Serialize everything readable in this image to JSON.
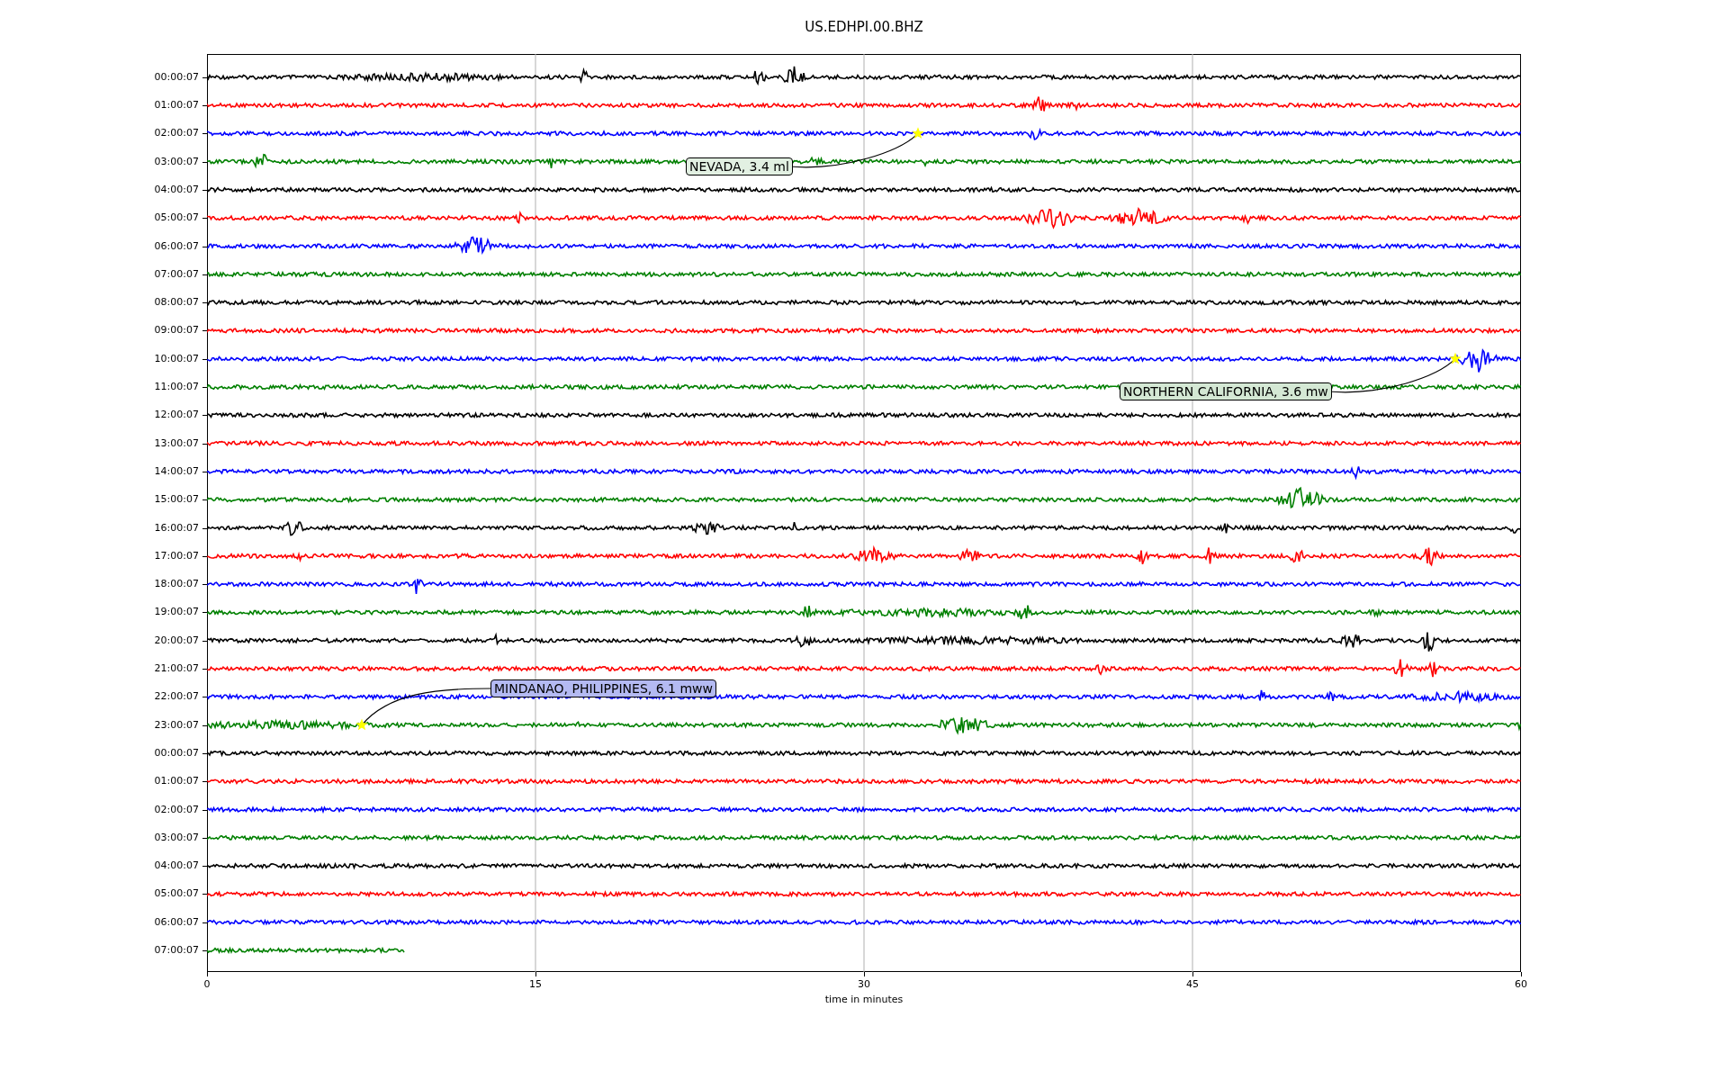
{
  "title": "US.EDHPI.00.BHZ",
  "plot": {
    "rows": [
      {
        "label": "00:00:07",
        "color": "#000000",
        "level": 1
      },
      {
        "label": "01:00:07",
        "color": "#ff0000",
        "level": 1
      },
      {
        "label": "02:00:07",
        "color": "#0000ff",
        "level": 1
      },
      {
        "label": "03:00:07",
        "color": "#008000",
        "level": 1
      },
      {
        "label": "04:00:07",
        "color": "#000000",
        "level": 1
      },
      {
        "label": "05:00:07",
        "color": "#ff0000",
        "level": 1
      },
      {
        "label": "06:00:07",
        "color": "#0000ff",
        "level": 1
      },
      {
        "label": "07:00:07",
        "color": "#008000",
        "level": 1
      },
      {
        "label": "08:00:07",
        "color": "#000000",
        "level": 1
      },
      {
        "label": "09:00:07",
        "color": "#ff0000",
        "level": 1
      },
      {
        "label": "10:00:07",
        "color": "#0000ff",
        "level": 1
      },
      {
        "label": "11:00:07",
        "color": "#008000",
        "level": 1
      },
      {
        "label": "12:00:07",
        "color": "#000000",
        "level": 1
      },
      {
        "label": "13:00:07",
        "color": "#ff0000",
        "level": 1
      },
      {
        "label": "14:00:07",
        "color": "#0000ff",
        "level": 1
      },
      {
        "label": "15:00:07",
        "color": "#008000",
        "level": 1
      },
      {
        "label": "16:00:07",
        "color": "#000000",
        "level": 1
      },
      {
        "label": "17:00:07",
        "color": "#ff0000",
        "level": 1
      },
      {
        "label": "18:00:07",
        "color": "#0000ff",
        "level": 1
      },
      {
        "label": "19:00:07",
        "color": "#008000",
        "level": 1
      },
      {
        "label": "20:00:07",
        "color": "#000000",
        "level": 1
      },
      {
        "label": "21:00:07",
        "color": "#ff0000",
        "level": 1
      },
      {
        "label": "22:00:07",
        "color": "#0000ff",
        "level": 1
      },
      {
        "label": "23:00:07",
        "color": "#008000",
        "level": 1
      },
      {
        "label": "00:00:07",
        "color": "#000000",
        "level": 1
      },
      {
        "label": "01:00:07",
        "color": "#ff0000",
        "level": 1
      },
      {
        "label": "02:00:07",
        "color": "#0000ff",
        "level": 1
      },
      {
        "label": "03:00:07",
        "color": "#008000",
        "level": 1
      },
      {
        "label": "04:00:07",
        "color": "#000000",
        "level": 1
      },
      {
        "label": "05:00:07",
        "color": "#ff0000",
        "level": 1
      },
      {
        "label": "06:00:07",
        "color": "#0000ff",
        "level": 1
      },
      {
        "label": "07:00:07",
        "color": "#008000",
        "level": 0.15
      }
    ],
    "xticks": [
      "0",
      "15",
      "30",
      "45",
      "60"
    ],
    "xlabel": "time in minutes",
    "annotations": [
      {
        "text": "NEVADA, 3.4 ml",
        "color": "#e2f0e2"
      },
      {
        "text": "NORTHERN CALIFORNIA, 3.6 mw",
        "color": "#d4e8d4"
      },
      {
        "text": "MINDANAO, PHILIPPINES, 6.1 mww",
        "color": "#b4baf2"
      }
    ]
  }
}
